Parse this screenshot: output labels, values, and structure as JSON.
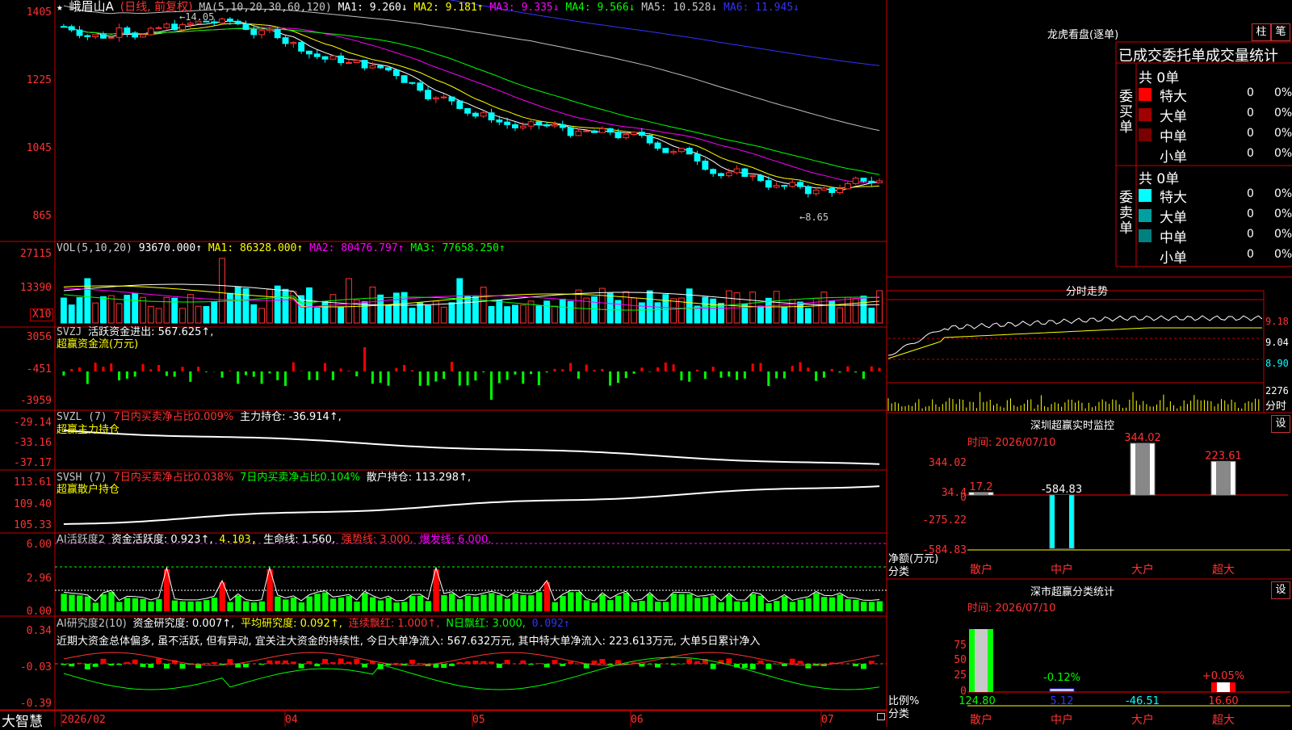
{
  "header": {
    "star": "★",
    "stock_name": "峨眉山A",
    "period": "(日线, 前复权)",
    "ma_params": "MA(5,10,20,30,60,120)",
    "ma1": "MA1: 9.260↓",
    "ma2": "MA2: 9.181↑",
    "ma3": "MA3: 9.335↓",
    "ma4": "MA4: 9.566↓",
    "ma5": "MA5: 10.528↓",
    "ma6": "MA6: 11.945↓",
    "high_mark": "←14.05",
    "low_mark": "←8.65"
  },
  "price_axis": [
    "1405",
    "1225",
    "1045",
    "865"
  ],
  "vol_panel": {
    "title": "VOL(5,10,20)",
    "vol": "93670.000↑",
    "ma1": "MA1: 86328.000↑",
    "ma2": "MA2: 80476.797↑",
    "ma3": "MA3: 77658.250↑",
    "axis": [
      "27115",
      "13390"
    ],
    "unit": "X10"
  },
  "svzj_panel": {
    "title": "SVZJ",
    "label": "活跃资金进出: 567.625↑,",
    "sub": "超赢资金流(万元)",
    "axis": [
      "3056",
      "-451",
      "-3959"
    ]
  },
  "svzl_panel": {
    "title": "SVZL (7)",
    "net7": "7日内买卖净占比0.009%",
    "hold": "主力持仓: -36.914↑,",
    "sub": "超赢主力持仓",
    "axis": [
      "-29.14",
      "-33.16",
      "-37.17"
    ]
  },
  "svsh_panel": {
    "title": "SVSH (7)",
    "net7a": "7日内买卖净占比0.038%",
    "net7b": "7日内买卖净占比0.104%",
    "hold": "散户持仓: 113.298↑,",
    "sub": "超赢散户持仓",
    "axis": [
      "113.61",
      "109.40",
      "105.33"
    ]
  },
  "ai_active": {
    "title": "AI活跃度2",
    "fund": "资金活跃度: 0.923↑,",
    "val2": "4.103,",
    "life": "生命线: 1.560,",
    "strong": "强势线: 3.000,",
    "burst": "爆发线: 6.000,",
    "axis": [
      "6.00",
      "2.96",
      "0.00"
    ]
  },
  "ai_research": {
    "title": "AI研究度2(10)",
    "fund": "资金研究度: 0.007↑,",
    "avg": "平均研究度: 0.092↑,",
    "cont": "连续飘红: 1.000↑,",
    "nday": "N日飘红: 3.000,",
    "last": "0.092↑",
    "commentary": "近期大资金总体偏多, 虽不活跃, 但有异动, 宜关注大资金的持续性, 今日大单净流入: 567.632万元, 其中特大单净流入: 223.613万元, 大单5日累计净入",
    "axis": [
      "0.34",
      "-0.03",
      "-0.39"
    ]
  },
  "bottom_bar": {
    "brand": "大智慧",
    "dates": [
      "2026/02",
      "04",
      "05",
      "06",
      "07"
    ]
  },
  "right_top": {
    "title": "龙虎看盘(逐单)",
    "btn1": "柱",
    "btn2": "笔",
    "tabs": "已成交委托单成交量统计",
    "buy_label": "委买单",
    "sell_label": "委卖单",
    "buy_total": "共 0单",
    "sell_total": "共 0单",
    "buy_rows": [
      {
        "name": "特大",
        "count": "0",
        "pct": "0%",
        "color": "#ff0000"
      },
      {
        "name": "大单",
        "count": "0",
        "pct": "0%",
        "color": "#a00000"
      },
      {
        "name": "中单",
        "count": "0",
        "pct": "0%",
        "color": "#780000"
      },
      {
        "name": "小单",
        "count": "0",
        "pct": "0%",
        "color": ""
      }
    ],
    "sell_rows": [
      {
        "name": "特大",
        "count": "0",
        "pct": "0%",
        "color": "#00ffff"
      },
      {
        "name": "大单",
        "count": "0",
        "pct": "0%",
        "color": "#00a0a0"
      },
      {
        "name": "中单",
        "count": "0",
        "pct": "0%",
        "color": "#008080"
      },
      {
        "name": "小单",
        "count": "0",
        "pct": "0%",
        "color": ""
      }
    ]
  },
  "intraday": {
    "title": "分时走势",
    "axis": [
      "9.18",
      "9.04",
      "8.90"
    ],
    "vol_axis": [
      "2276",
      "分时"
    ]
  },
  "sz_monitor": {
    "title": "深圳超赢实时监控",
    "btn": "设",
    "time": "时间: 2026/07/10",
    "axis": [
      "344.02",
      "34.4",
      "0",
      "-275.22",
      "-584.83"
    ],
    "ylabel1": "净额(万元)",
    "ylabel2": "分类",
    "categories": [
      "散户",
      "中户",
      "大户",
      "超大"
    ],
    "values": [
      17.2,
      -584.83,
      344.02,
      223.61
    ],
    "labels": [
      "17.2",
      "-584.83",
      "344.02",
      "223.61"
    ]
  },
  "sz_class": {
    "title": "深市超赢分类统计",
    "btn": "设",
    "time": "时间: 2026/07/10",
    "axis": [
      "75",
      "50",
      "25",
      "0"
    ],
    "ylabel1": "比例%",
    "ylabel2": "分类",
    "categories": [
      "散户",
      "中户",
      "大户",
      "超大"
    ],
    "values": [
      124.8,
      5.12,
      -46.51,
      16.6
    ],
    "top_labels": [
      "",
      "-0.12%",
      "",
      "+0.05%"
    ],
    "bottom_labels": [
      "124.80",
      "5.12",
      "-46.51",
      "16.60"
    ]
  },
  "colors": {
    "up": "#ff3232",
    "down": "#00ffff",
    "ma1": "#ffffff",
    "ma2": "#ffff00",
    "ma3": "#ff00ff",
    "ma4": "#00ff00",
    "ma5": "#c0c0c0",
    "ma6": "#3232ff",
    "border": "#c80000"
  }
}
